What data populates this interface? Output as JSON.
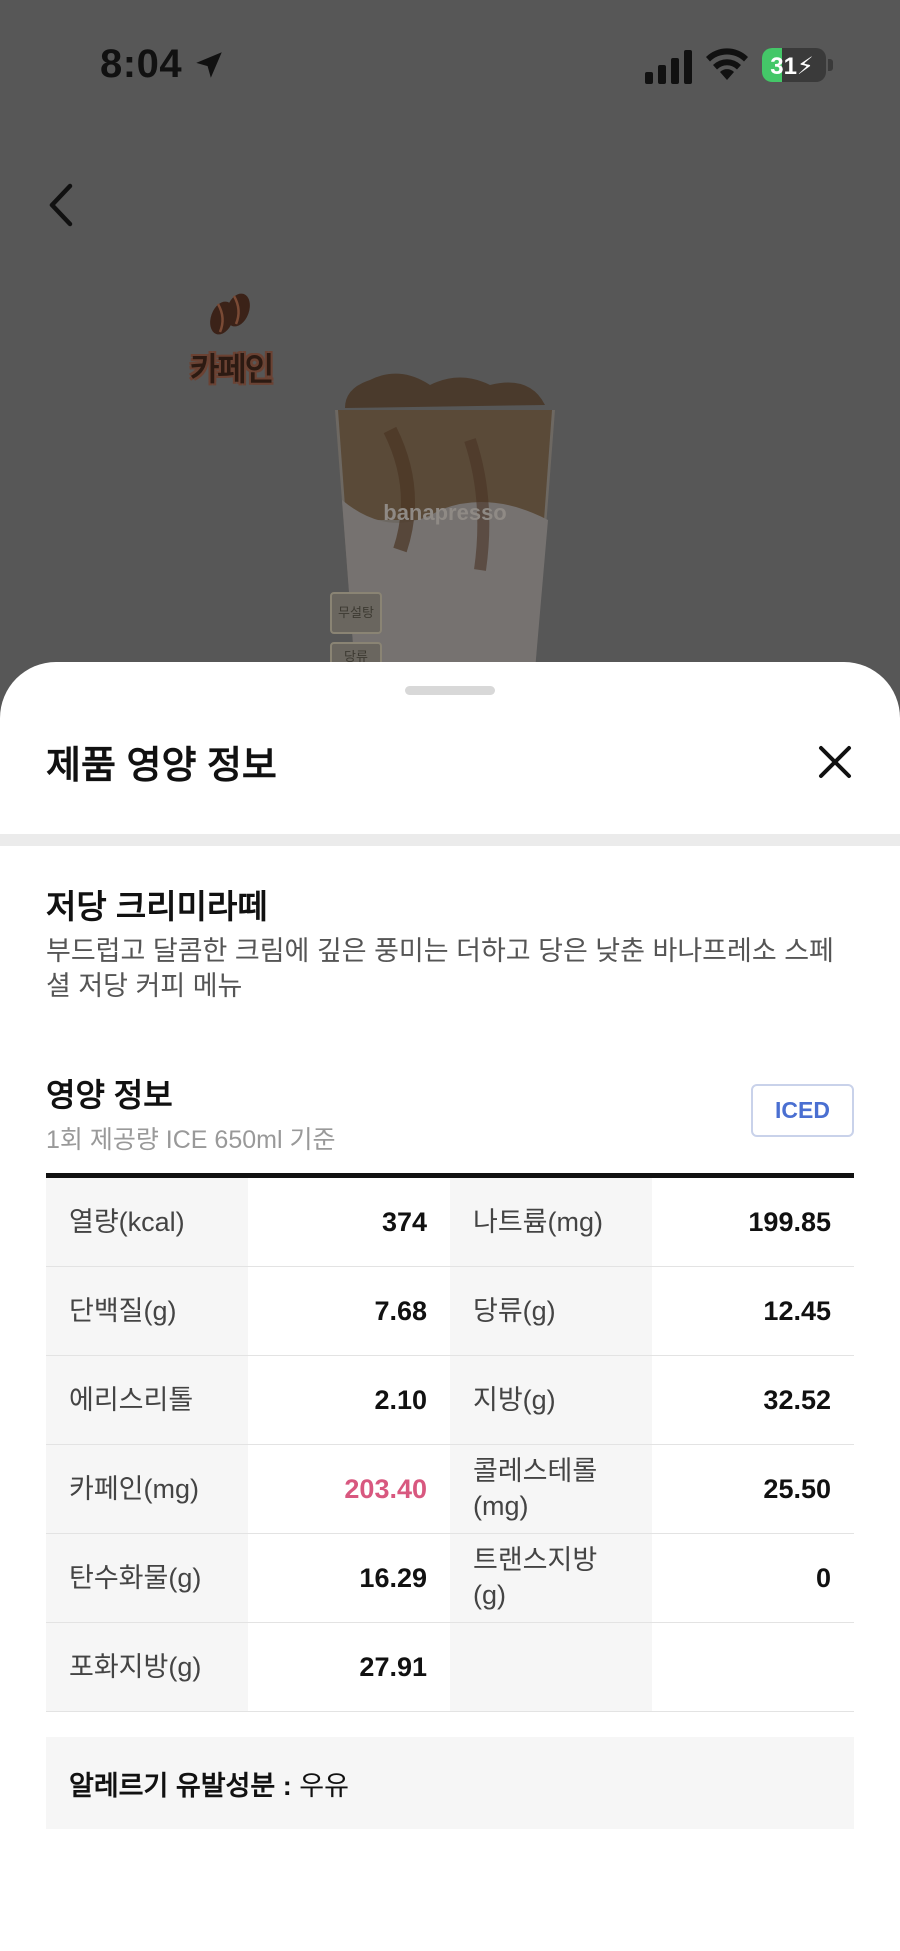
{
  "status_bar": {
    "time": "8:04",
    "battery_percent": 31,
    "battery_label": "31",
    "icons": [
      "location-arrow-icon",
      "cellular-signal-icon",
      "wifi-icon",
      "battery-charging-icon"
    ]
  },
  "background": {
    "back_icon": "chevron-left-icon",
    "caffeine_badge_label": "카페인",
    "cup_logo_text": "banapresso",
    "tags": [
      "무설탕",
      "당류"
    ]
  },
  "sheet": {
    "title": "제품 영양 정보",
    "close_icon": "close-icon",
    "product_name": "저당 크리미라떼",
    "product_description": "부드럽고 달콤한 크림에 깊은 풍미는 더하고 당은 낮춘 바나프레소 스페셜 저당 커피 메뉴",
    "nutrition_title": "영양 정보",
    "serving_basis": "1회 제공량 ICE 650ml 기준",
    "temperature_badge": "ICED",
    "accent_color": "#d8587f",
    "rows": [
      [
        {
          "label": "열량(kcal)",
          "value": "374"
        },
        {
          "label": "나트륨(mg)",
          "value": "199.85"
        }
      ],
      [
        {
          "label": "단백질(g)",
          "value": "7.68"
        },
        {
          "label": "당류(g)",
          "value": "12.45"
        }
      ],
      [
        {
          "label": "에리스리톨",
          "value": "2.10"
        },
        {
          "label": "지방(g)",
          "value": "32.52"
        }
      ],
      [
        {
          "label": "카페인(mg)",
          "value": "203.40"
        },
        {
          "label": "콜레스테롤(mg)",
          "value": "25.50"
        }
      ],
      [
        {
          "label": "탄수화물(g)",
          "value": "16.29"
        },
        {
          "label": "트랜스지방(g)",
          "value": "0"
        }
      ],
      [
        {
          "label": "포화지방(g)",
          "value": "27.91"
        },
        {
          "label": "",
          "value": ""
        }
      ]
    ],
    "allergy_label": "알레르기 유발성분 :",
    "allergy_value": "우유"
  }
}
